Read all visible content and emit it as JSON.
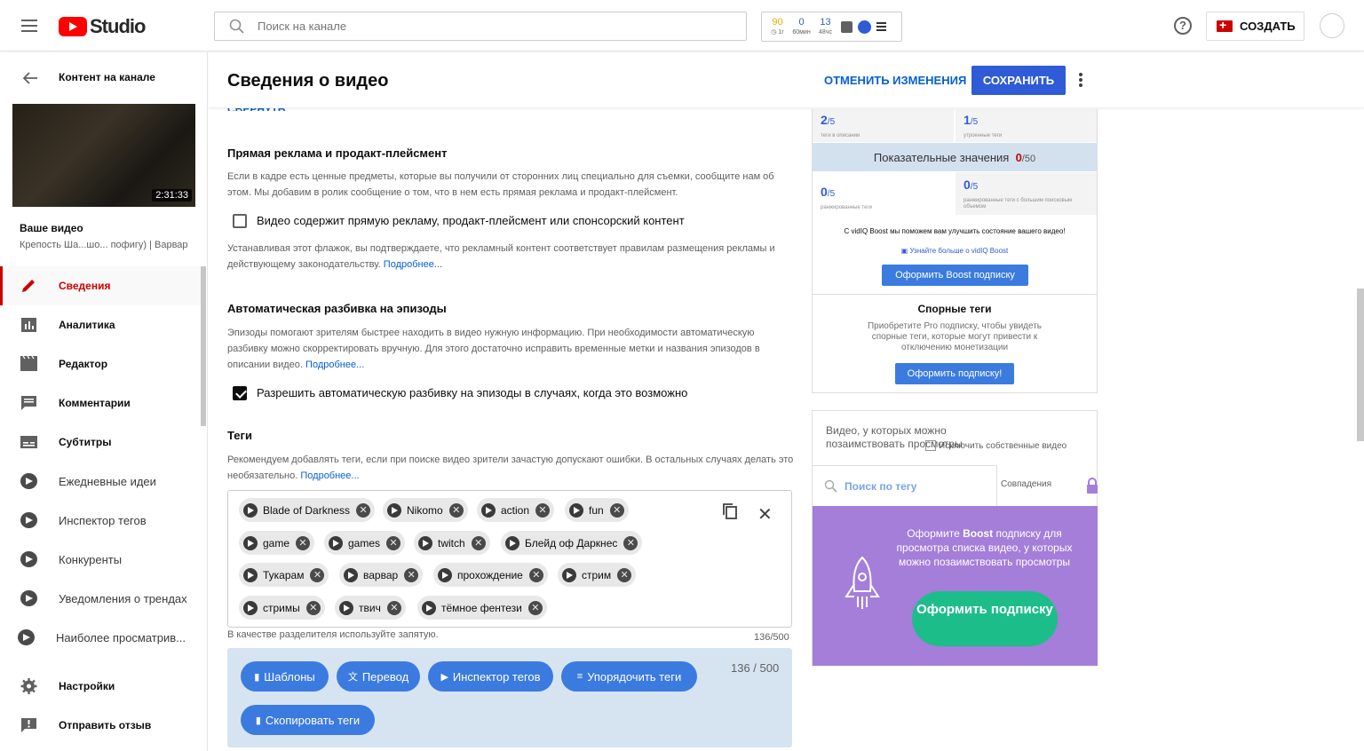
{
  "app": {
    "brand": "Studio"
  },
  "search": {
    "placeholder": "Поиск на канале"
  },
  "vidiq_stats": [
    {
      "value": "90",
      "label": "1г",
      "color": "#e8a800"
    },
    {
      "value": "0",
      "label": "60мин",
      "color": "#2f5bd6"
    },
    {
      "value": "13",
      "label": "48чс",
      "color": "#2f5bd6"
    }
  ],
  "header": {
    "create_label": "СОЗДАТЬ"
  },
  "sidebar": {
    "back_title": "Контент на канале",
    "thumb_duration": "2:31:33",
    "your_video": "Ваше видео",
    "video_title": "Крепость Ша...шо... пофигу) | Варвар",
    "items": [
      {
        "label": "Сведения",
        "icon": "pencil-icon"
      },
      {
        "label": "Аналитика",
        "icon": "analytics-icon"
      },
      {
        "label": "Редактор",
        "icon": "editor-icon"
      },
      {
        "label": "Комментарии",
        "icon": "comments-icon"
      },
      {
        "label": "Субтитры",
        "icon": "subtitles-icon"
      },
      {
        "label": "Ежедневные идеи",
        "icon": "vidiq-icon"
      },
      {
        "label": "Инспектор тегов",
        "icon": "vidiq-icon"
      },
      {
        "label": "Конкуренты",
        "icon": "vidiq-icon"
      },
      {
        "label": "Уведомления о трендах",
        "icon": "vidiq-icon"
      },
      {
        "label": "Наиболее просматрив...",
        "icon": "vidiq-icon"
      },
      {
        "label": "Настройки",
        "icon": "gear-icon"
      },
      {
        "label": "Отправить отзыв",
        "icon": "feedback-icon"
      }
    ]
  },
  "main": {
    "title": "Сведения о видео",
    "undo_label": "ОТМЕНИТЬ ИЗМЕНЕНИЯ",
    "save_label": "СОХРАНИТЬ",
    "collapse_label": "СВЕРНУТЬ",
    "ads": {
      "heading": "Прямая реклама и продакт-плейсмент",
      "text": "Если в кадре есть ценные предметы, которые вы получили от сторонних лиц специально для съемки, сообщите нам об этом. Мы добавим в ролик сообщение о том, что в нем есть прямая реклама и продакт-плейсмент.",
      "checkbox_label": "Видео содержит прямую рекламу, продакт-плейсмент или спонсорский контент",
      "checked": false,
      "note": "Устанавливая этот флажок, вы подтверждаете, что рекламный контент соответствует правилам размещения рекламы и действующему законодательству.",
      "more": "Подробнее..."
    },
    "chapters": {
      "heading": "Автоматическая разбивка на эпизоды",
      "text": "Эпизоды помогают зрителям быстрее находить в видео нужную информацию. При необходимости автоматическую разбивку можно скорректировать вручную. Для этого достаточно исправить временные метки и названия эпизодов в описании видео.",
      "more": "Подробнее...",
      "checkbox_label": "Разрешить автоматическую разбивку на эпизоды в случаях, когда это возможно",
      "checked": true
    },
    "tags": {
      "heading": "Теги",
      "text": "Рекомендуем добавлять теги, если при поиске видео зрители зачастую допускают ошибки. В остальных случаях делать это необязательно.",
      "more": "Подробнее...",
      "items": [
        "Blade of Darkness",
        "Nikomo",
        "action",
        "fun",
        "game",
        "games",
        "twitch",
        "Блейд оф Даркнес",
        "Тукарам",
        "варвар",
        "прохождение",
        "стрим",
        "стримы",
        "твич",
        "тёмное фентези"
      ],
      "hint": "В качестве разделителя используйте запятую.",
      "count": "136/500",
      "panel_count": "136 / 500",
      "buttons": [
        "Шаблоны",
        "Перевод",
        "Инспектор тегов",
        "Упорядочить теги",
        "Скопировать теги"
      ]
    }
  },
  "vidiq": {
    "cells": [
      {
        "value": "2",
        "max": "/5",
        "label": "теги в описании"
      },
      {
        "value": "1",
        "max": "/5",
        "label": "утроенные теги"
      },
      {
        "value": "0",
        "max": "/5",
        "label": "ранжированные теги"
      },
      {
        "value": "0",
        "max": "/5",
        "label": "ранжированные теги с большим поисковым объемом"
      }
    ],
    "score_label": "Показательные значения",
    "score_value": "0",
    "score_max": "/50",
    "boost_text": "С vidIQ Boost мы поможем вам улучшить состояние вашего видео!",
    "learn_more": "Узнайте больше о vidIQ Boost",
    "boost_btn": "Оформить Boost подписку",
    "disputed_title": "Спорные теги",
    "disputed_text": "Приобретите Pro подписку, чтобы увидеть спорные теги, которые могут привести к отключению монетизации",
    "disputed_btn": "Оформить подписку!",
    "borrow_title": "Видео, у которых можно позаимствовать просмотры",
    "exclude_label": "Исключить собственные видео",
    "tag_search": "Поиск по тегу",
    "matches": "Совпадения",
    "promo_pre": "Оформите ",
    "promo_bold": "Boost",
    "promo_post": " подписку для просмотра списка видео, у которых можно позаимствовать просмотры",
    "promo_btn": "Оформить подписку"
  },
  "colors": {
    "accent": "#cc0000",
    "link": "#065fd4",
    "save": "#2f5bd6",
    "promo": "#a47ed9",
    "promo_btn": "#1dbd8a"
  }
}
